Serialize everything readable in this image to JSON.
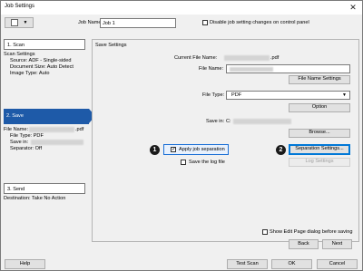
{
  "window": {
    "title": "Job Settings",
    "close_glyph": "✕"
  },
  "top": {
    "job_name_label": "Job Name",
    "job_name_value": "Job 1",
    "disable_label": "Disable job setting changes on control panel"
  },
  "steps": {
    "scan": {
      "label": "1. Scan"
    },
    "scan_info": [
      "Scan Settings",
      "Source: ADF - Single-sided",
      "Document Size: Auto Detect",
      "Image Type: Auto"
    ],
    "save": {
      "label": "2. Save"
    },
    "save_info": [
      "File Name:",
      "File Type: PDF",
      "Save in:",
      "Separator: Off"
    ],
    "save_file_ext": ".pdf",
    "send": {
      "label": "3. Send"
    },
    "send_info": "Destination: Take No Action"
  },
  "save_settings": {
    "title": "Save Settings",
    "current_file_name_label": "Current File Name:",
    "current_file_ext": ".pdf",
    "file_name_label": "File Name:",
    "file_name_settings_button": "File Name Settings",
    "file_type_label": "File Type:",
    "file_type_value": "PDF",
    "option_button": "Option",
    "save_in_label": "Save in:",
    "save_in_value": "C:",
    "browse_button": "Browse...",
    "apply_separation_label": "Apply job separation",
    "save_log_label": "Save the log file",
    "separation_settings_button": "Separation Settings...",
    "log_settings_button": "Log Settings"
  },
  "callouts": {
    "one": "1",
    "two": "2"
  },
  "bottom": {
    "show_edit_label": "Show Edit Page dialog before saving",
    "back_button": "Back",
    "next_button": "Next",
    "help_button": "Help",
    "test_scan_button": "Test Scan",
    "ok_button": "OK",
    "cancel_button": "Cancel"
  }
}
